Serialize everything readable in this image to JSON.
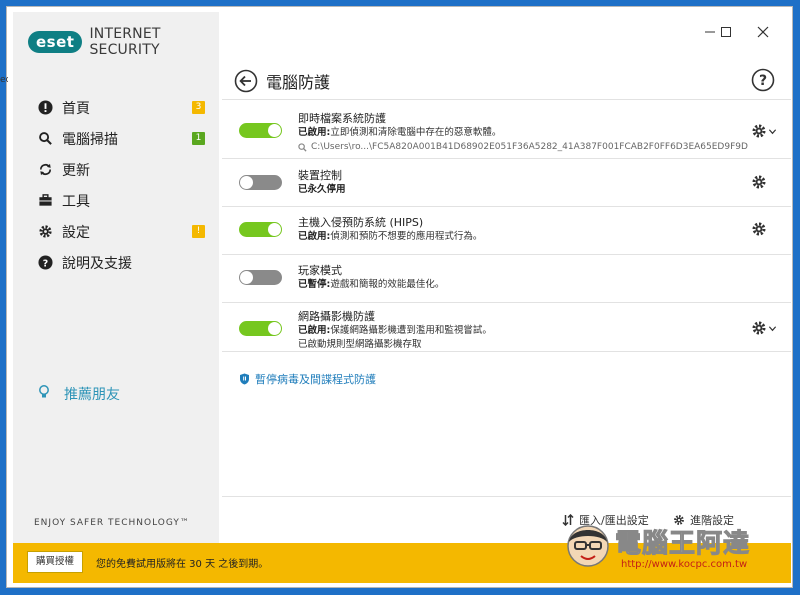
{
  "app": {
    "logo": "eset",
    "product": "INTERNET SECURITY",
    "tagline": "ENJOY SAFER TECHNOLOGY™"
  },
  "desktop": {
    "sliver_text": "ec"
  },
  "sidebar": {
    "items": [
      {
        "label": "首頁",
        "icon": "alert-circle-icon",
        "badge": "3",
        "badge_color": "#f4b800"
      },
      {
        "label": "電腦掃描",
        "icon": "search-icon",
        "badge": "1",
        "badge_color": "#5aa71f"
      },
      {
        "label": "更新",
        "icon": "refresh-icon",
        "badge": "",
        "badge_color": ""
      },
      {
        "label": "工具",
        "icon": "briefcase-icon",
        "badge": "",
        "badge_color": ""
      },
      {
        "label": "設定",
        "icon": "gear-icon",
        "badge": "!",
        "badge_color": "#f4b800"
      },
      {
        "label": "說明及支援",
        "icon": "help-circle-icon",
        "badge": "",
        "badge_color": ""
      }
    ],
    "refer_friend": "推薦朋友"
  },
  "header": {
    "title": "電腦防護"
  },
  "modules": [
    {
      "name": "即時檔案系統防護",
      "status_label": "已啟用:",
      "status_text": "立即偵測和清除電腦中存在的惡意軟體。",
      "path": "C:\\Users\\ro...\\FC5A820A001B41D68902E051F36A5282_41A387F001FCAB2F0FF6D3EA65ED9F9D",
      "extra": "",
      "enabled": true,
      "has_chevron": true
    },
    {
      "name": "裝置控制",
      "status_label": "已永久停用",
      "status_text": "",
      "path": "",
      "extra": "",
      "enabled": false,
      "has_chevron": false
    },
    {
      "name": "主機入侵預防系統 (HIPS)",
      "status_label": "已啟用:",
      "status_text": "偵測和預防不想要的應用程式行為。",
      "path": "",
      "extra": "",
      "enabled": true,
      "has_chevron": false
    },
    {
      "name": "玩家模式",
      "status_label": "已暫停:",
      "status_text": "遊戲和簡報的效能最佳化。",
      "path": "",
      "extra": "",
      "enabled": false,
      "has_chevron": false
    },
    {
      "name": "網路攝影機防護",
      "status_label": "已啟用:",
      "status_text": "保護網路攝影機遭到濫用和監視嘗試。",
      "path": "",
      "extra": "已啟動規則型網路攝影機存取",
      "enabled": true,
      "has_chevron": true
    }
  ],
  "pause_link": "暫停病毒及間諜程式防護",
  "bottom": {
    "import_export": "匯入/匯出設定",
    "advanced": "進階設定"
  },
  "footer": {
    "buy_label": "購買授權",
    "trial_text": "您的免費試用版將在 30 天 之後到期。"
  },
  "watermark": {
    "text": "電腦王阿達",
    "url": "http://www.kocpc.com.tw"
  },
  "colors": {
    "accent": "#0f7f84",
    "toggle_on": "#76c71f",
    "toggle_off": "#8a8a8a",
    "footer": "#f4b800",
    "link": "#1f7dbb"
  }
}
